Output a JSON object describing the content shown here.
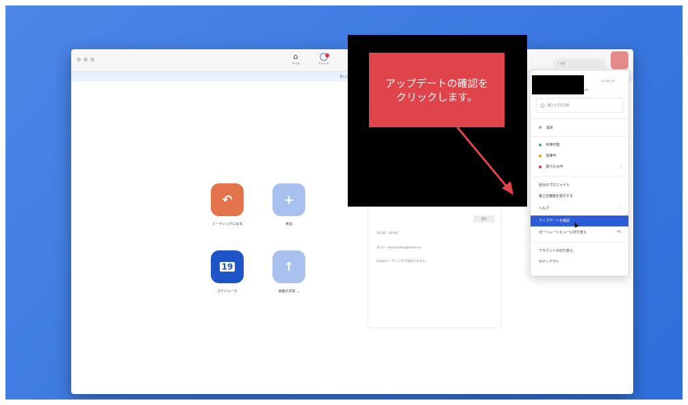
{
  "nav": {
    "home_label": "ホーム",
    "chat_label": "チャット",
    "search_placeholder": "検索"
  },
  "banner": {
    "text": "新しいバージョンが"
  },
  "actions": [
    {
      "label": "ミーティングに戻る",
      "icon": "return-arrow-icon",
      "color": "#e2734a"
    },
    {
      "label": "参加",
      "icon": "plus-icon",
      "color": "#a9c1ee"
    },
    {
      "label": "スケジュール",
      "icon": "calendar-icon",
      "date": "19",
      "color": "#1f54c8"
    },
    {
      "label": "画面の共有",
      "icon": "share-screen-icon",
      "color": "#a9c1ee"
    }
  ],
  "calendar": {
    "button": "開始",
    "time": "10:30 - 10:00",
    "host": "ホスト: maria.ohno@zoom.us",
    "note": "Zoomミーティングではありません"
  },
  "menu": {
    "license": "ライセンス",
    "memo": "個人メモを追加",
    "settings": "設定",
    "status_available": "利用可能",
    "status_away": "退席中",
    "status_busy": "取り込み中",
    "profile": "自分のプロファイル",
    "features": "最上位機能を試行する",
    "help": "ヘルプ",
    "check_updates": "アップデートを確認",
    "portrait": "ポートレートビューに切り替え",
    "portrait_shortcut": "⌘L",
    "switch_account": "アカウントの切り替え",
    "signout": "サインアウト"
  },
  "callout": {
    "text": "アップデートの確認を\nクリックします。"
  },
  "colors": {
    "desktop": "#3a78e0",
    "highlight": "#2e5bd6",
    "callout": "#e0444b",
    "available": "#3db06a",
    "away": "#e0a11a",
    "busy": "#d9334b"
  }
}
